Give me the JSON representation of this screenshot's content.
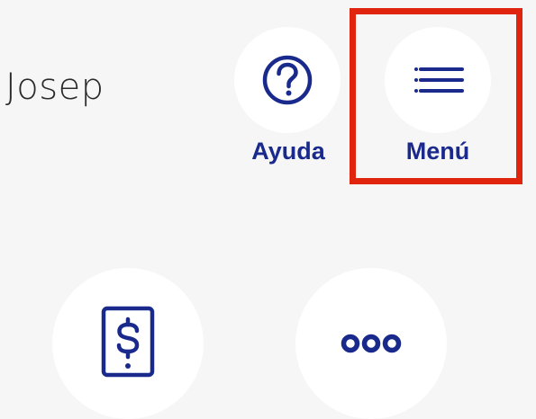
{
  "header": {
    "greeting_name": "Josep"
  },
  "actions": {
    "help": {
      "label": "Ayuda",
      "icon": "question-circle-icon"
    },
    "menu": {
      "label": "Menú",
      "icon": "hamburger-menu-icon"
    }
  },
  "quick_actions": [
    {
      "icon": "mobile-payment-icon"
    },
    {
      "icon": "more-options-icon"
    }
  ],
  "colors": {
    "accent": "#1a2a8c",
    "highlight": "#e0240d",
    "background": "#f6f6f6",
    "surface": "#ffffff"
  }
}
